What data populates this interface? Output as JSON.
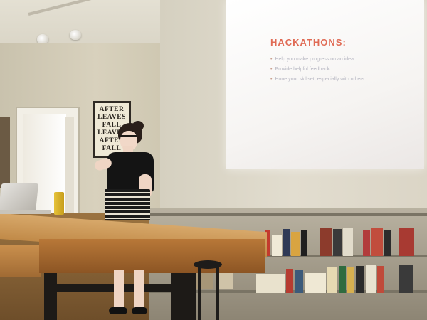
{
  "slide": {
    "title": "HACKATHONS:",
    "bullets": [
      "Help you make progress on an idea",
      "Provide helpful feedback",
      "Hone your skillset, especially with others"
    ]
  },
  "poster": {
    "lines": [
      "AFTER",
      "LEAVES",
      "FALL",
      "LEAVES",
      "AFTER",
      "FALL"
    ]
  },
  "colors": {
    "slide_title": "#e06b55",
    "slide_text": "#b7b7c2",
    "table_wood": "#c18a48",
    "floor_wood": "#8a6233"
  }
}
